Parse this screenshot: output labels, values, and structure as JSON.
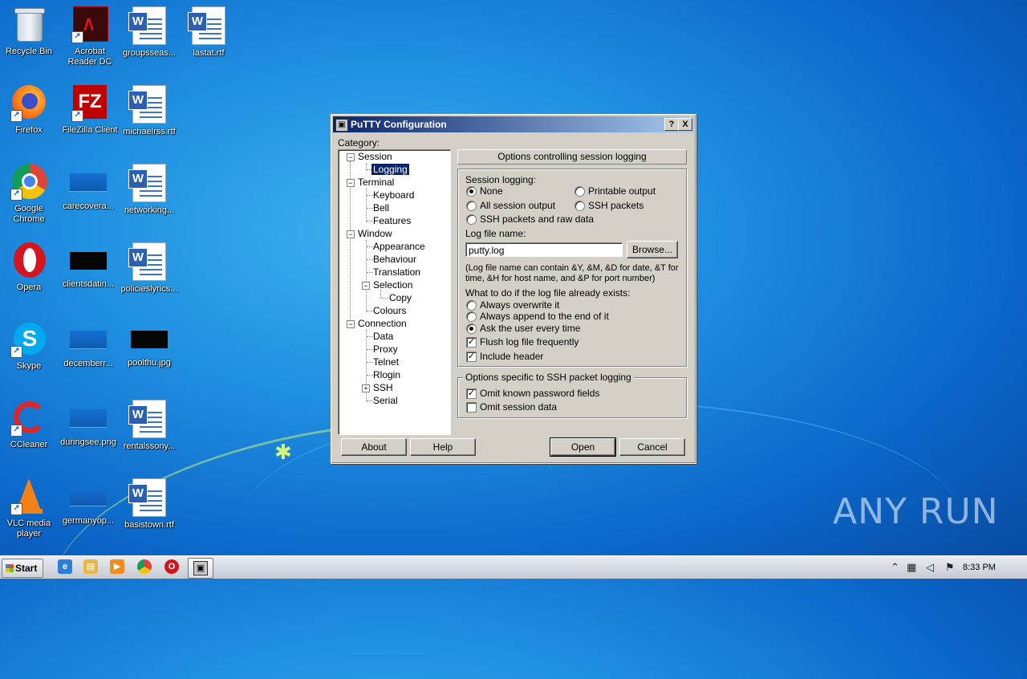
{
  "desktop": {
    "icons": [
      {
        "label": "Recycle Bin",
        "icon": "recycle-bin-icon"
      },
      {
        "label": "Acrobat Reader DC",
        "icon": "acrobat-icon"
      },
      {
        "label": "groupsseas...",
        "icon": "word-doc-icon"
      },
      {
        "label": "lastat.rtf",
        "icon": "word-doc-icon"
      },
      {
        "label": "Firefox",
        "icon": "firefox-icon"
      },
      {
        "label": "FileZilla Client",
        "icon": "filezilla-icon"
      },
      {
        "label": "michaelrss.rtf",
        "icon": "word-doc-icon"
      },
      {
        "label": "Google Chrome",
        "icon": "chrome-icon"
      },
      {
        "label": "carecovera...",
        "icon": "image-file-icon"
      },
      {
        "label": "networking...",
        "icon": "word-doc-icon"
      },
      {
        "label": "Opera",
        "icon": "opera-icon"
      },
      {
        "label": "clientsdatin...",
        "icon": "image-file-icon"
      },
      {
        "label": "policieslyrics...",
        "icon": "word-doc-icon"
      },
      {
        "label": "Skype",
        "icon": "skype-icon"
      },
      {
        "label": "decemberr...",
        "icon": "image-file-icon"
      },
      {
        "label": "poolthu.jpg",
        "icon": "image-file-icon"
      },
      {
        "label": "CCleaner",
        "icon": "ccleaner-icon"
      },
      {
        "label": "duringsee.png",
        "icon": "image-file-icon"
      },
      {
        "label": "rentalssony...",
        "icon": "word-doc-icon"
      },
      {
        "label": "VLC media player",
        "icon": "vlc-icon"
      },
      {
        "label": "germanyop...",
        "icon": "image-file-icon"
      },
      {
        "label": "basistown.rtf",
        "icon": "word-doc-icon"
      }
    ],
    "watermark": "ANY RUN"
  },
  "window": {
    "title": "PuTTY Configuration",
    "help_btn": "?",
    "close_btn": "X",
    "category_label": "Category:",
    "tree": {
      "session": "Session",
      "logging": "Logging",
      "terminal": "Terminal",
      "keyboard": "Keyboard",
      "bell": "Bell",
      "features": "Features",
      "window": "Window",
      "appearance": "Appearance",
      "behaviour": "Behaviour",
      "translation": "Translation",
      "selection": "Selection",
      "copy": "Copy",
      "colours": "Colours",
      "connection": "Connection",
      "data": "Data",
      "proxy": "Proxy",
      "telnet": "Telnet",
      "rlogin": "Rlogin",
      "ssh": "SSH",
      "serial": "Serial"
    },
    "panel_header": "Options controlling session logging",
    "session_logging": {
      "title": "Session logging:",
      "none": "None",
      "printable": "Printable output",
      "all": "All session output",
      "ssh_packets": "SSH packets",
      "ssh_raw": "SSH packets and raw data",
      "selected": "None"
    },
    "log_file_label": "Log file name:",
    "log_file_value": "putty.log",
    "browse": "Browse...",
    "hint_line1": "(Log file name can contain &Y, &M, &D for date, &T for",
    "hint_line2": "time, &H for host name, and &P for port number)",
    "exists_label": "What to do if the log file already exists:",
    "exists_options": {
      "overwrite": "Always overwrite it",
      "append": "Always append to the end of it",
      "ask": "Ask the user every time",
      "selected": "Ask the user every time"
    },
    "flush": {
      "label": "Flush log file frequently",
      "checked": true
    },
    "include_header": {
      "label": "Include header",
      "checked": true
    },
    "ssh_group": {
      "title": "Options specific to SSH packet logging",
      "omit_password": {
        "label": "Omit known password fields",
        "checked": true
      },
      "omit_session": {
        "label": "Omit session data",
        "checked": false
      }
    },
    "buttons": {
      "about": "About",
      "help": "Help",
      "open": "Open",
      "cancel": "Cancel"
    }
  },
  "taskbar": {
    "start": "Start",
    "clock": "8:33 PM"
  }
}
